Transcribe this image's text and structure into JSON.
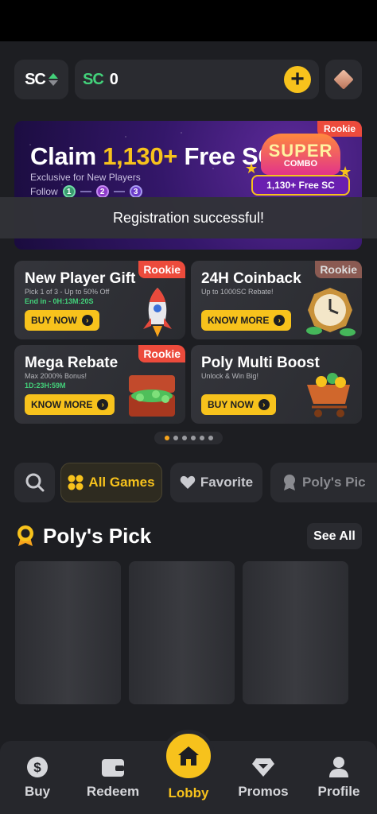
{
  "topbar": {
    "currency_toggle_label": "SC",
    "balance_currency": "SC",
    "balance_value": "0"
  },
  "banner": {
    "tag": "Rookie",
    "title_prefix": "Claim ",
    "title_highlight": "1,130+",
    "title_suffix": " Free SC",
    "subtitle": "Exclusive for New Players",
    "follow_label": "Follow",
    "steps": [
      "1",
      "2",
      "3"
    ],
    "combo_line1": "SUPER",
    "combo_line2": "COMBO",
    "combo_amount": "1,130+ Free SC"
  },
  "toast": {
    "message": "Registration successful!"
  },
  "promo_cards": [
    {
      "title": "New Player Gift",
      "sub1": "Pick 1 of 3 - Up to 50% Off",
      "sub2": "End in - 0H:13M:20S",
      "button": "BUY NOW",
      "tag": "Rookie"
    },
    {
      "title": "24H Coinback",
      "sub1": "Up to 1000SC Rebate!",
      "sub2": "",
      "button": "KNOW MORE",
      "tag": "Rookie"
    },
    {
      "title": "Mega Rebate",
      "sub1": "Max 2000% Bonus!",
      "sub2": "1D:23H:59M",
      "button": "KNOW MORE",
      "tag": "Rookie"
    },
    {
      "title": "Poly Multi Boost",
      "sub1": "Unlock & Win Big!",
      "sub2": "",
      "button": "BUY NOW",
      "tag": ""
    }
  ],
  "carousel": {
    "total": 6,
    "active_index": 0
  },
  "filters": {
    "all_games": "All Games",
    "favorite": "Favorite",
    "polys_pick": "Poly's Pic"
  },
  "polys_pick": {
    "title": "Poly's Pick",
    "see_all": "See All"
  },
  "bottom_nav": {
    "buy": "Buy",
    "redeem": "Redeem",
    "lobby": "Lobby",
    "promos": "Promos",
    "profile": "Profile"
  },
  "colors": {
    "accent": "#f7c21c",
    "background": "#1d1e22",
    "card": "#2a2b30",
    "rookie_tag": "#ec4b3c",
    "green": "#43d17a"
  }
}
